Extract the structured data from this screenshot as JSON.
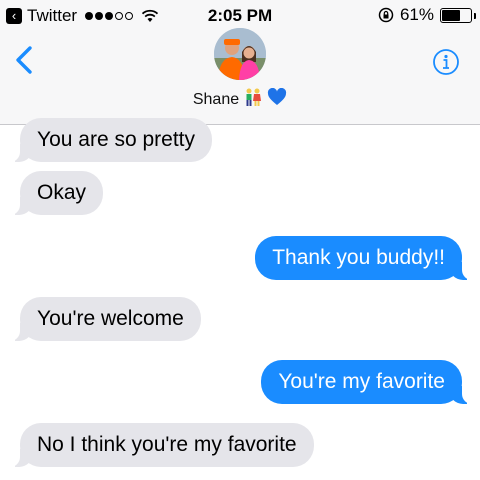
{
  "status_bar": {
    "carrier": "Twitter",
    "time": "2:05 PM",
    "battery": "61%",
    "battery_level": 0.61,
    "signal_bars_filled": 3,
    "signal_bars_total": 5
  },
  "header": {
    "contact_name": "Shane",
    "back_icon": "chevron-left",
    "info_icon": "info-circle",
    "name_emojis": "👫💙"
  },
  "messages": [
    {
      "side": "received",
      "text": "You are so pretty"
    },
    {
      "side": "received",
      "text": "Okay"
    },
    {
      "side": "sent",
      "text": "Thank you buddy!!"
    },
    {
      "side": "received",
      "text": "You're welcome"
    },
    {
      "side": "sent",
      "text": "You're my favorite"
    },
    {
      "side": "received",
      "text": "No I think you're my favorite"
    }
  ],
  "colors": {
    "sent_bubble": "#1a8cff",
    "received_bubble": "#e5e5ea",
    "accent": "#1a8cff"
  }
}
